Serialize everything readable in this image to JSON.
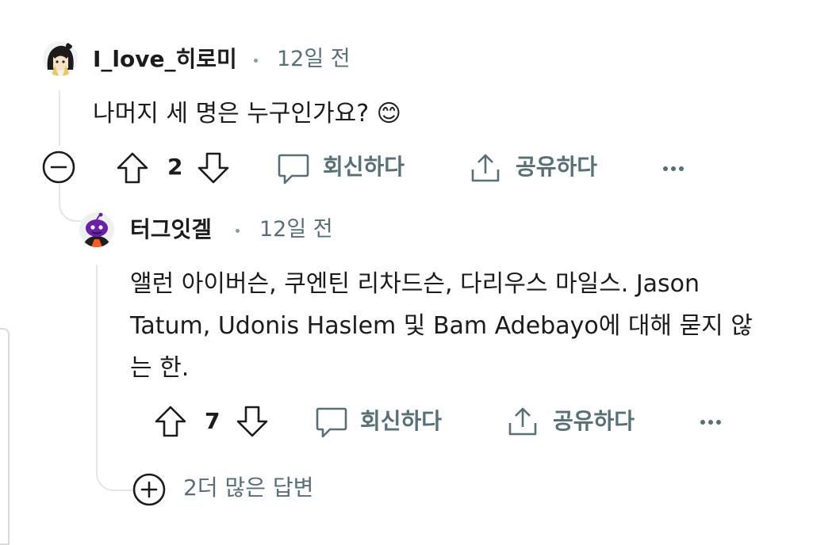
{
  "comment": {
    "username": "I_love_히로미",
    "time": "12일 전",
    "body": "나머지 세 명은 누구인가요? 😊",
    "votes": "2",
    "reply_label": "회신하다",
    "share_label": "공유하다",
    "avatar_icon": "anime-character-avatar",
    "collapse_icon": "minus-circle-icon"
  },
  "reply": {
    "username": "터그잇겔",
    "time": "12일 전",
    "body_lines": [
      "앨런 아이버슨, 쿠엔틴 리차드슨, 다리우스 마일스. Jason",
      "Tatum, Udonis Haslem 및 Bam Adebayo에 대해 묻지 않",
      "는 한."
    ],
    "votes": "7",
    "reply_label": "회신하다",
    "share_label": "공유하다",
    "avatar_icon": "snoo-avatar"
  },
  "more_replies": {
    "label": "2더 많은 답변",
    "icon": "plus-circle-icon"
  },
  "colors": {
    "text": "#1c1c1c",
    "secondary": "#576f76",
    "thread_line": "#e3e6e8",
    "snoo_purple": "#6b1fa8"
  }
}
